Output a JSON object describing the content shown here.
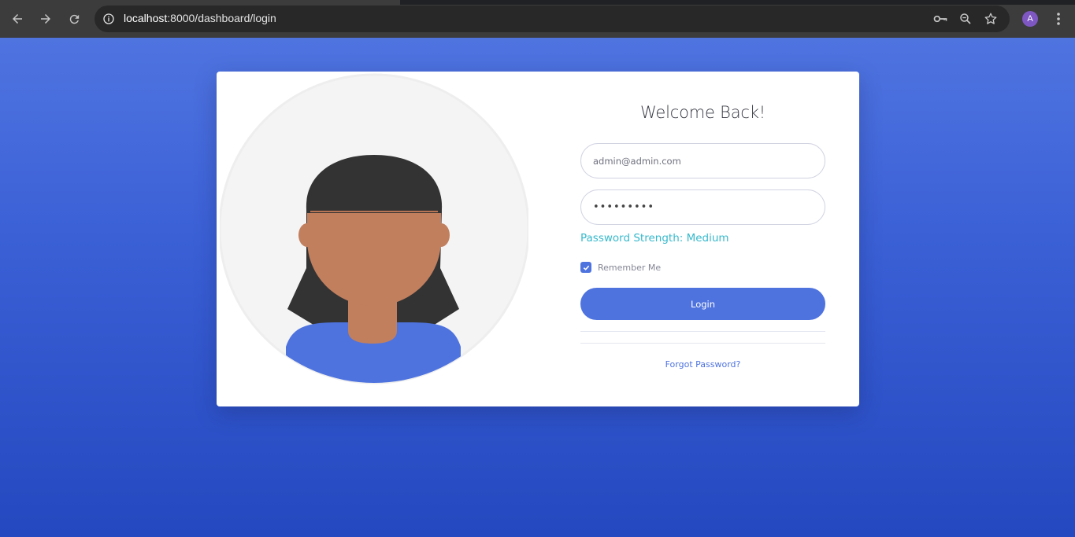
{
  "browser": {
    "url_host": "localhost",
    "url_rest": ":8000/dashboard/login",
    "profile_initial": "A",
    "icons": [
      "back-arrow-icon",
      "forward-arrow-icon",
      "reload-icon",
      "site-info-icon",
      "password-key-icon",
      "zoom-icon",
      "bookmark-star-icon",
      "more-vert-icon"
    ]
  },
  "login": {
    "title": "Welcome Back!",
    "email_value": "admin@admin.com",
    "password_value": "•••••••••",
    "strength_text": "Password Strength: Medium",
    "remember_label": "Remember Me",
    "remember_checked": true,
    "login_button": "Login",
    "forgot_link": "Forgot Password?"
  },
  "colors": {
    "primary": "#4e73df",
    "info": "#36b9cc",
    "background_top": "#4f74e0",
    "background_bottom": "#2448bf",
    "skin": "#c17f5e",
    "hair": "#333333",
    "shirt": "#4e73df"
  },
  "illustration": "woman-avatar-illustration"
}
